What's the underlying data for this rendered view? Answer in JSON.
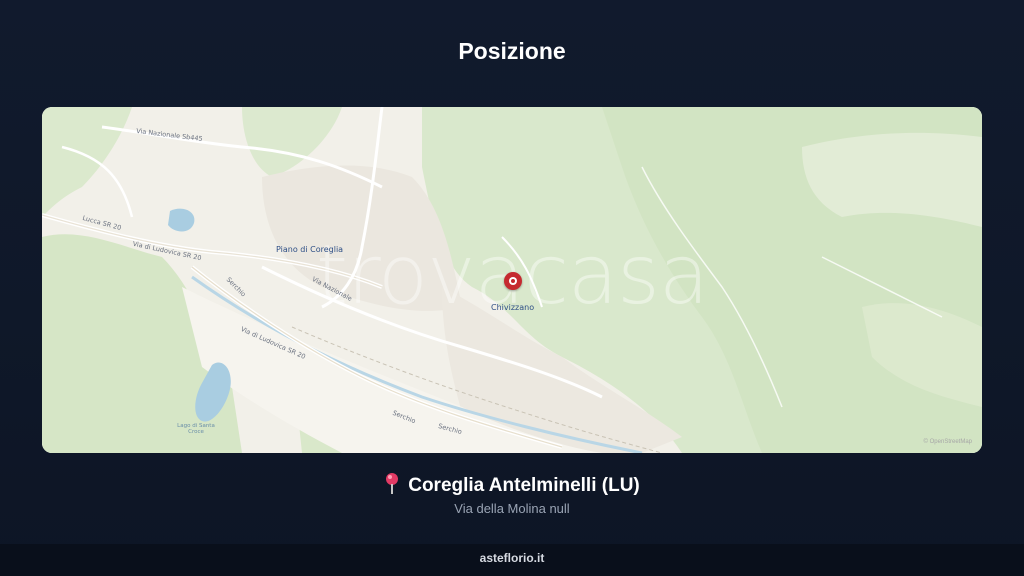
{
  "section_title": "Posizione",
  "map": {
    "watermark": "trovacasa",
    "places": [
      "Piano di Coreglia",
      "Chivizzano"
    ],
    "roads": [
      "Via Nazionale Sb445",
      "Via di Ludovica SR 20",
      "Via di Ludovica SR 20",
      "Via Nazionale",
      "Serchio",
      "Serchio",
      "Serchio",
      "Lucca SR 20"
    ],
    "water": [
      "Lago di Santa Croce"
    ],
    "attribution": "© OpenStreetMap",
    "marker": "location-marker"
  },
  "location": {
    "icon": "pushpin-icon",
    "city": "Coreglia Antelminelli (LU)",
    "address": "Via della Molina null"
  },
  "footer": {
    "site": "asteflorio.it"
  }
}
